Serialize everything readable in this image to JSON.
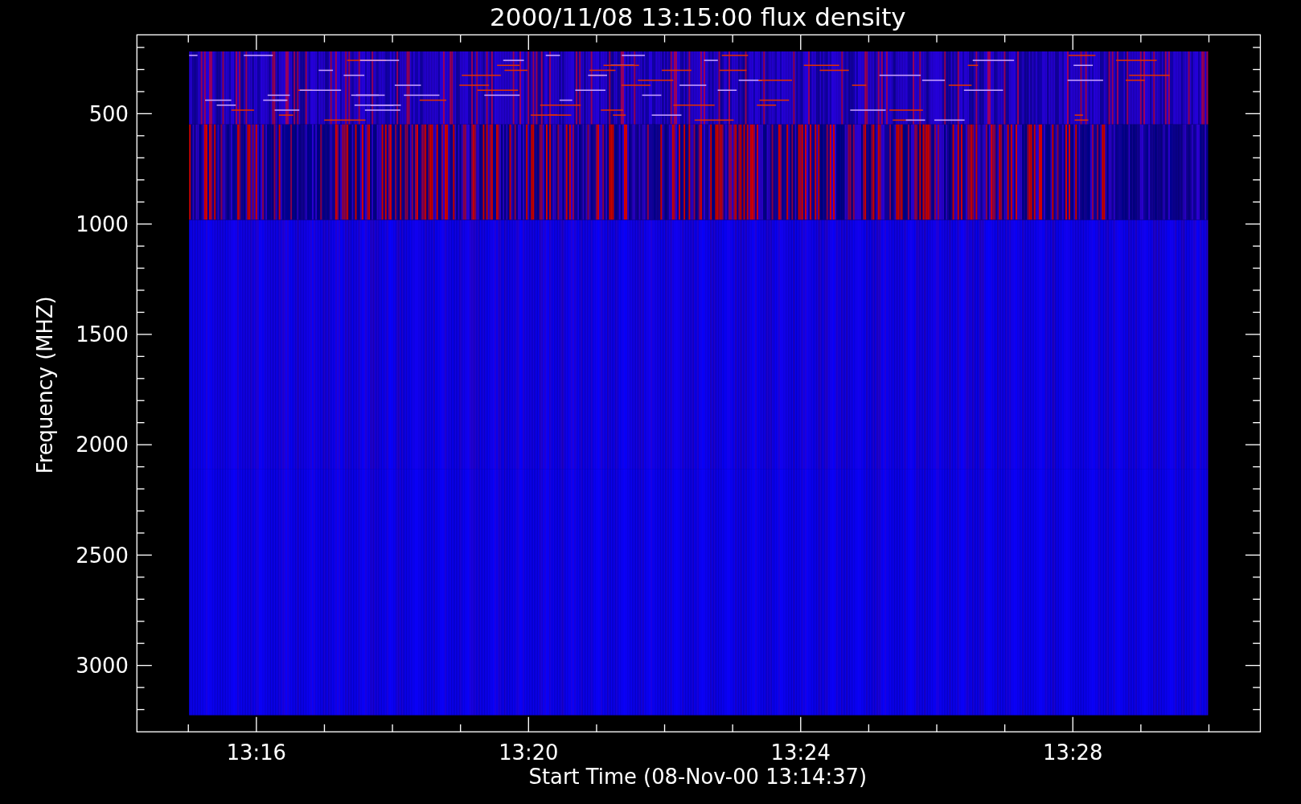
{
  "plot": {
    "title": "2000/11/08 13:15:00 flux density",
    "xlabel": "Start Time (08-Nov-00 13:14:37)",
    "ylabel": "Frequency (MHZ)",
    "xtick_labels": [
      "13:16",
      "13:20",
      "13:24",
      "13:28"
    ],
    "ytick_labels": [
      "500",
      "1000",
      "1500",
      "2000",
      "2500",
      "3000"
    ]
  }
}
